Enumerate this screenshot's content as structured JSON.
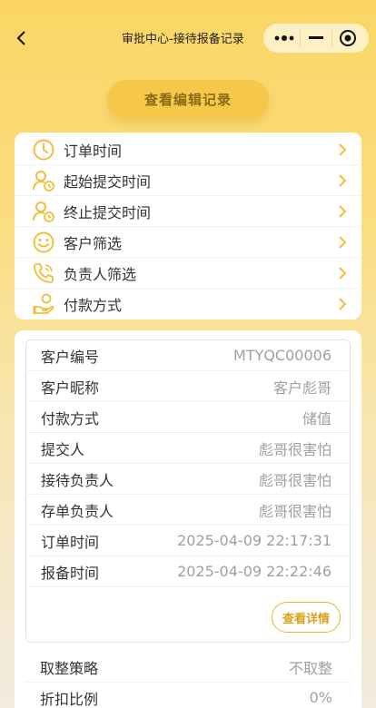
{
  "header": {
    "title": "审批中心-接待报备记录",
    "back_icon": "chevron-left-icon",
    "capsule": {
      "more_icon": "more-dots-icon",
      "minimize_icon": "minimize-icon",
      "close_icon": "target-close-icon"
    }
  },
  "edit_button": {
    "label": "查看编辑记录"
  },
  "filters": {
    "items": [
      {
        "icon": "clock-icon",
        "label": "订单时间"
      },
      {
        "icon": "user-clock-icon",
        "label": "起始提交时间"
      },
      {
        "icon": "user-clock-icon",
        "label": "终止提交时间"
      },
      {
        "icon": "smile-icon",
        "label": "客户筛选"
      },
      {
        "icon": "phone-icon",
        "label": "负责人筛选"
      },
      {
        "icon": "hand-coin-icon",
        "label": "付款方式"
      }
    ]
  },
  "record": {
    "rows": [
      {
        "key": "客户编号",
        "value": "MTYQC00006"
      },
      {
        "key": "客户昵称",
        "value": "客户彪哥"
      },
      {
        "key": "付款方式",
        "value": "储值"
      },
      {
        "key": "提交人",
        "value": "彪哥很害怕"
      },
      {
        "key": "接待负责人",
        "value": "彪哥很害怕"
      },
      {
        "key": "存单负责人",
        "value": "彪哥很害怕"
      },
      {
        "key": "订单时间",
        "value": "2025-04-09 22:17:31"
      },
      {
        "key": "报备时间",
        "value": "2025-04-09 22:22:46"
      }
    ],
    "detail_button": "查看详情",
    "extra_rows": [
      {
        "key": "取整策略",
        "value": "不取整"
      },
      {
        "key": "折扣比例",
        "value": "0%"
      }
    ]
  },
  "colors": {
    "accent": "#f5c84a",
    "icon": "#f2be3a",
    "button_text": "#8a6a14"
  }
}
